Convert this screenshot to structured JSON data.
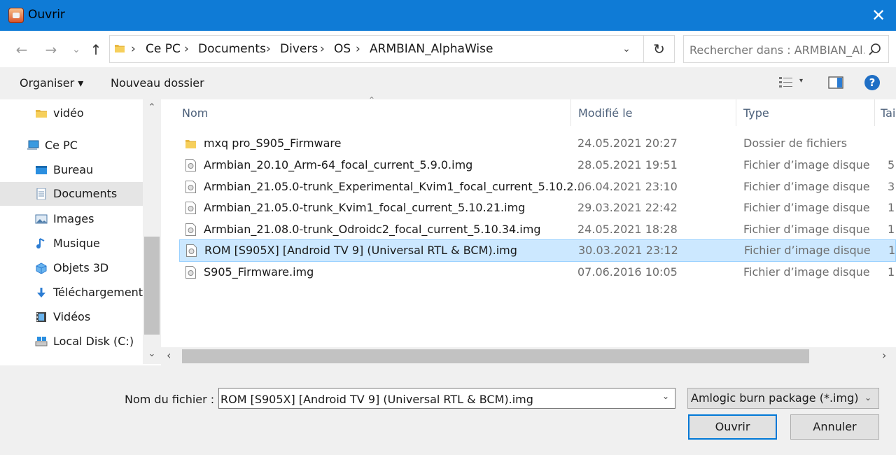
{
  "window": {
    "title": "Ouvrir",
    "close_glyph": "✕"
  },
  "nav_buttons": {
    "back": "←",
    "forward": "→",
    "recent": "⌄",
    "up": "↑"
  },
  "address": {
    "crumbs": [
      "Ce PC",
      "Documents",
      "Divers",
      "OS",
      "ARMBIAN_AlphaWise"
    ],
    "separator": "›",
    "dropdown_glyph": "⌄",
    "refresh_glyph": "↻"
  },
  "search": {
    "placeholder": "Rechercher dans : ARMBIAN_Al..."
  },
  "toolbar": {
    "organiser": "Organiser ▾",
    "new_folder": "Nouveau dossier",
    "view_drop": "▾",
    "help": "?"
  },
  "sidebar": {
    "items": [
      {
        "label": "vidéo",
        "icon": "folder-icon"
      },
      {
        "label": "Ce PC",
        "icon": "computer-icon"
      },
      {
        "label": "Bureau",
        "icon": "desktop-icon"
      },
      {
        "label": "Documents",
        "icon": "documents-icon",
        "selected": true
      },
      {
        "label": "Images",
        "icon": "pictures-icon"
      },
      {
        "label": "Musique",
        "icon": "music-icon"
      },
      {
        "label": "Objets 3D",
        "icon": "objects-3d-icon"
      },
      {
        "label": "Téléchargements",
        "icon": "downloads-icon"
      },
      {
        "label": "Vidéos",
        "icon": "videos-icon"
      },
      {
        "label": "Local Disk (C:)",
        "icon": "drive-icon"
      }
    ],
    "scroll_up": "⌃",
    "scroll_down": "⌄"
  },
  "columns": {
    "name": "Nom",
    "modified": "Modifié le",
    "type": "Type",
    "size": "Tai",
    "sort_glyph": "⌃"
  },
  "files": [
    {
      "name": "mxq pro_S905_Firmware",
      "modified": "24.05.2021 20:27",
      "type": "Dossier de fichiers",
      "size": "",
      "kind": "folder"
    },
    {
      "name": "Armbian_20.10_Arm-64_focal_current_5.9.0.img",
      "modified": "28.05.2021 19:51",
      "type": "Fichier d’image disque",
      "size": "5",
      "kind": "image"
    },
    {
      "name": "Armbian_21.05.0-trunk_Experimental_Kvim1_focal_current_5.10.2...",
      "modified": "06.04.2021 23:10",
      "type": "Fichier d’image disque",
      "size": "3",
      "kind": "image"
    },
    {
      "name": "Armbian_21.05.0-trunk_Kvim1_focal_current_5.10.21.img",
      "modified": "29.03.2021 22:42",
      "type": "Fichier d’image disque",
      "size": "1",
      "kind": "image"
    },
    {
      "name": "Armbian_21.08.0-trunk_Odroidc2_focal_current_5.10.34.img",
      "modified": "24.05.2021 18:28",
      "type": "Fichier d’image disque",
      "size": "1",
      "kind": "image"
    },
    {
      "name": "ROM [S905X] [Android TV 9] (Universal RTL & BCM).img",
      "modified": "30.03.2021 23:12",
      "type": "Fichier d’image disque",
      "size": "1",
      "kind": "image",
      "selected": true
    },
    {
      "name": "S905_Firmware.img",
      "modified": "07.06.2016 10:05",
      "type": "Fichier d’image disque",
      "size": "1",
      "kind": "image"
    }
  ],
  "hscroll": {
    "left": "‹",
    "right": "›"
  },
  "footer": {
    "filename_label": "Nom du fichier :",
    "filename_value": "ROM [S905X] [Android TV 9] (Universal RTL & BCM).img",
    "filename_drop": "⌄",
    "filter": "Amlogic burn package (*.img)",
    "filter_drop": "⌄",
    "open": "Ouvrir",
    "cancel": "Annuler"
  },
  "colors": {
    "titlebar": "#0f7bd6",
    "selection": "#cce8ff",
    "selection_border": "#99d1ff",
    "accent": "#0078d7"
  }
}
